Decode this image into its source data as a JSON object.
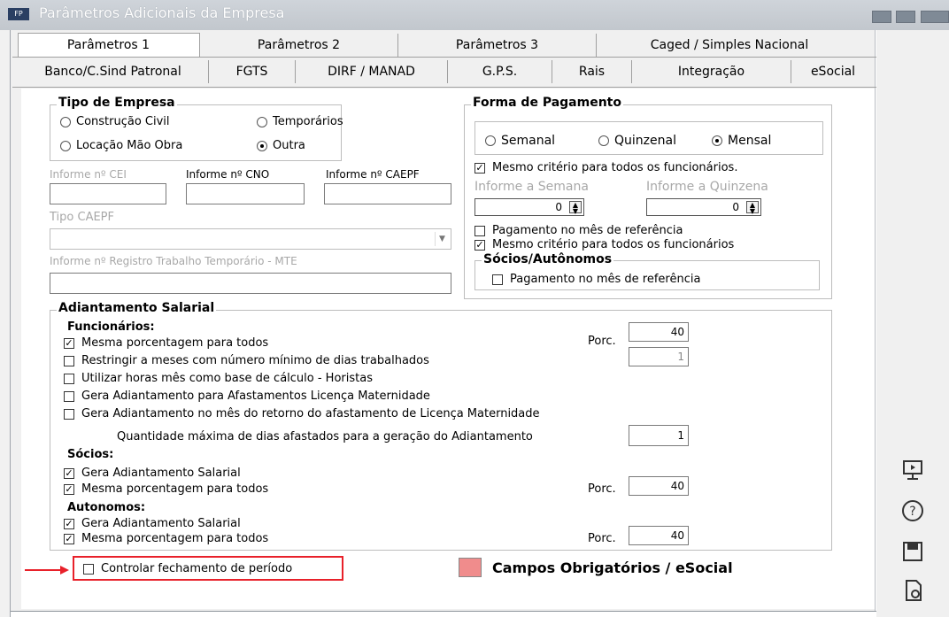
{
  "window": {
    "title": "Parâmetros Adicionais da Empresa",
    "icon_label": "FP"
  },
  "tabs_row1": [
    "Parâmetros 1",
    "Parâmetros 2",
    "Parâmetros 3",
    "Caged / Simples Nacional"
  ],
  "tabs_row2": [
    "Banco/C.Sind Patronal",
    "FGTS",
    "DIRF / MANAD",
    "G.P.S.",
    "Rais",
    "Integração",
    "eSocial"
  ],
  "tipo_empresa": {
    "legend": "Tipo de Empresa",
    "options": [
      "Construção Civil",
      "Temporários",
      "Locação Mão Obra",
      "Outra"
    ],
    "selected": "Outra"
  },
  "identificacao": {
    "cei_label": "Informe nº CEI",
    "cno_label": "Informe nº CNO",
    "caepf_label": "Informe nº CAEPF",
    "tipo_caepf_label": "Tipo CAEPF",
    "registro_label": "Informe nº Registro Trabalho Temporário - MTE"
  },
  "forma_pagamento": {
    "legend": "Forma de Pagamento",
    "options": [
      "Semanal",
      "Quinzenal",
      "Mensal"
    ],
    "selected": "Mensal",
    "mesmo_criterio_1": "Mesmo critério para todos os funcionários.",
    "semana_label": "Informe a Semana",
    "quinzena_label": "Informe a Quinzena",
    "semana_value": "0",
    "quinzena_value": "0",
    "pagamento_mes_ref": "Pagamento no mês de referência",
    "mesmo_criterio_2": "Mesmo critério para todos os funcionários",
    "socios_legend": "Sócios/Autônomos",
    "socios_pagamento": "Pagamento no mês de referência"
  },
  "adiantamento": {
    "legend": "Adiantamento Salarial",
    "funcionarios_title": "Funcionários:",
    "func_items": [
      "Mesma porcentagem para todos",
      "Restringir a meses com número mínimo de dias trabalhados",
      "Utilizar horas mês como base de cálculo - Horistas",
      "Gera Adiantamento para Afastamentos Licença Maternidade",
      "Gera Adiantamento no mês do retorno do afastamento de Licença Maternidade"
    ],
    "porc_label": "Porc.",
    "func_porc": "40",
    "func_min_dias": "1",
    "qtd_max_label": "Quantidade máxima de dias afastados para a geração do Adiantamento",
    "qtd_max_value": "1",
    "socios_title": "Sócios:",
    "socios_items": [
      "Gera Adiantamento Salarial",
      "Mesma porcentagem para todos"
    ],
    "socios_porc": "40",
    "autonomos_title": "Autonomos:",
    "autonomos_items": [
      "Gera Adiantamento Salarial",
      "Mesma porcentagem para todos"
    ],
    "autonomos_porc": "40"
  },
  "bottom": {
    "controlar_fechamento": "Controlar fechamento de período",
    "campos_obrigatorios": "Campos Obrigatórios / eSocial"
  },
  "colors": {
    "highlight_red": "#e8212a",
    "required_swatch": "#f08c8c"
  },
  "side_icons": [
    "monitor-icon",
    "help-icon",
    "save-icon",
    "report-icon"
  ]
}
